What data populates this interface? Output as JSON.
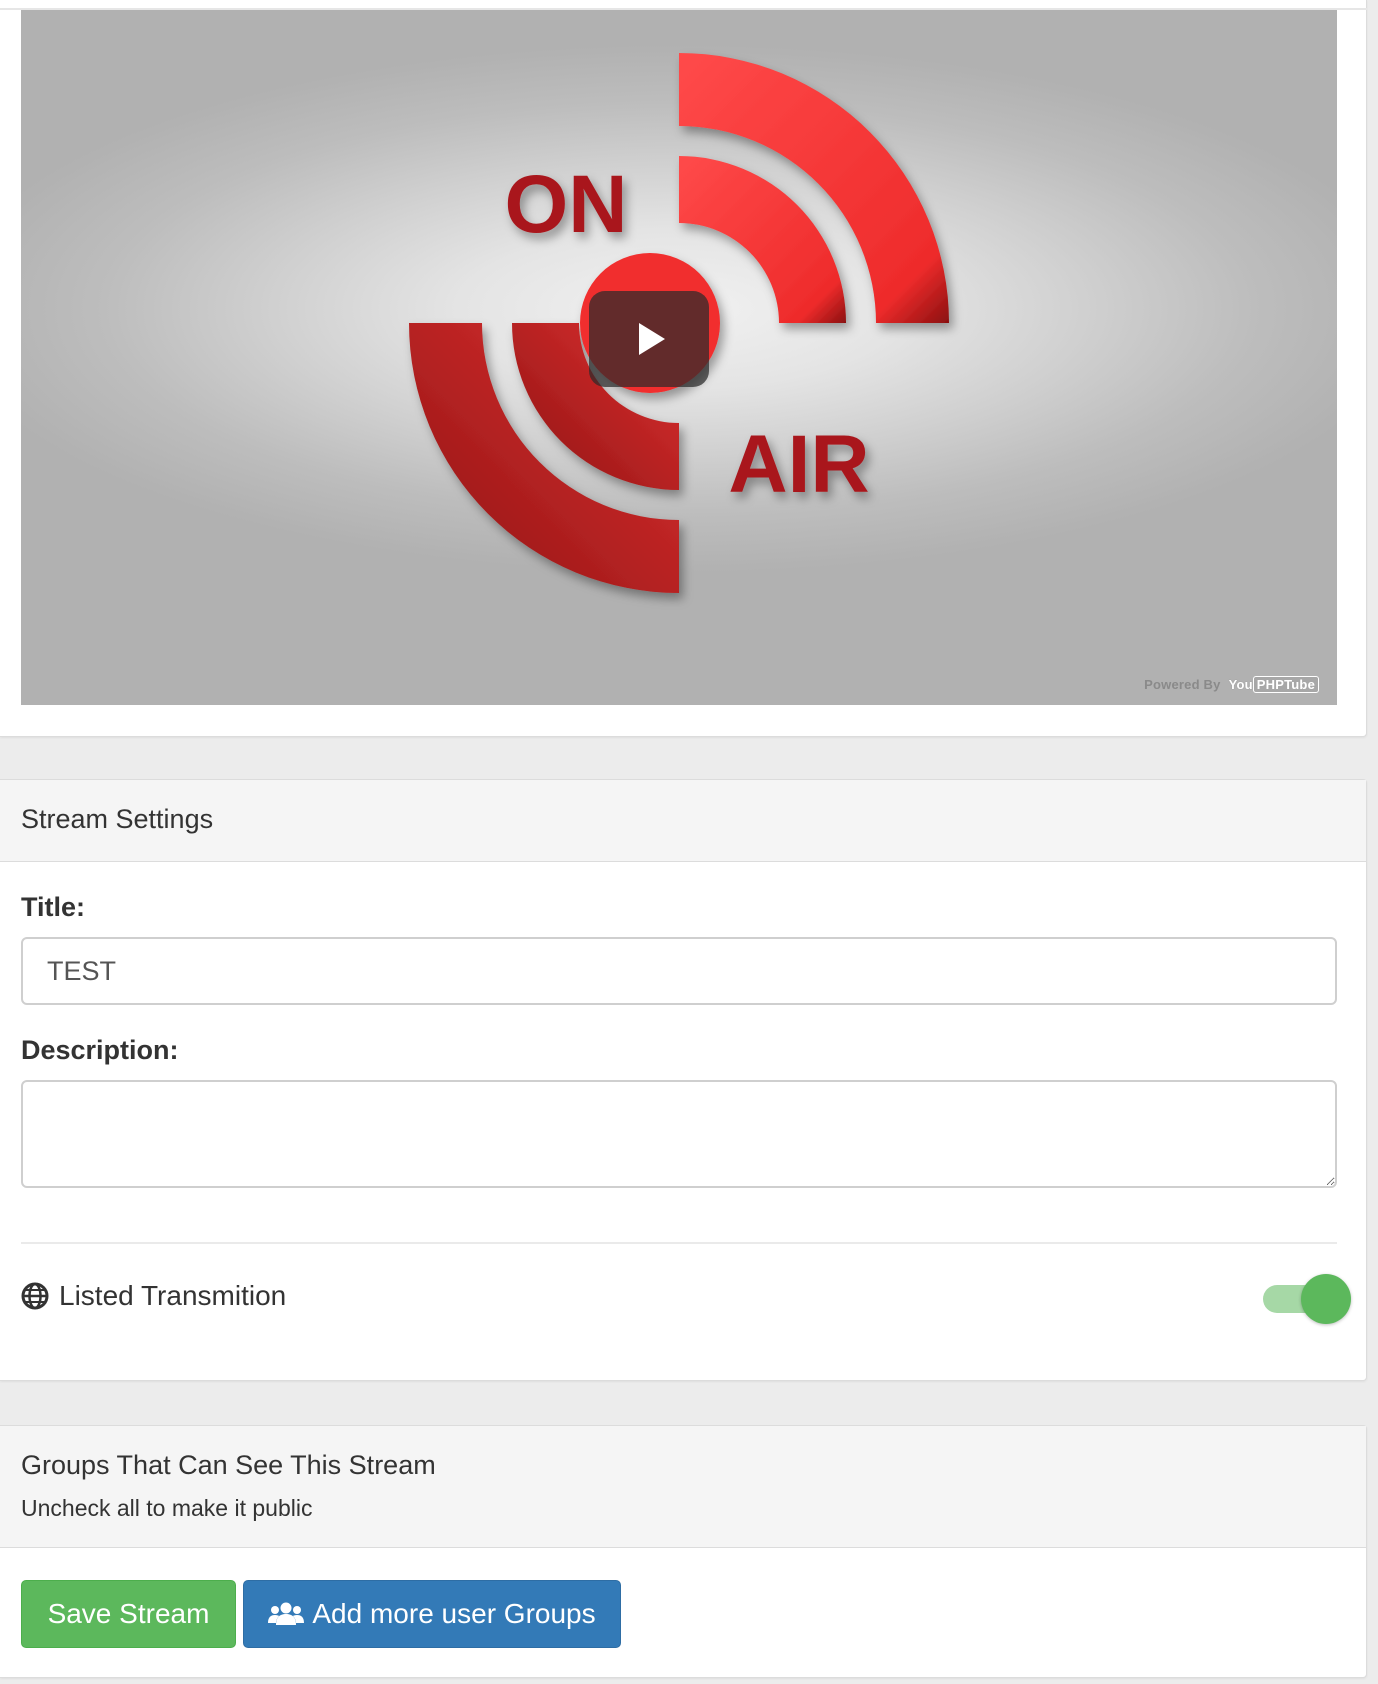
{
  "video": {
    "poster": {
      "top_word": "ON",
      "bottom_word": "AIR"
    },
    "play_icon": "play-icon",
    "powered_by_label": "Powered By",
    "brand_you": "You",
    "brand_php": "PHPTube"
  },
  "stream_settings": {
    "heading": "Stream Settings",
    "title_label": "Title:",
    "title_value": "TEST",
    "description_label": "Description:",
    "description_value": "",
    "listed_icon": "globe-icon",
    "listed_label": "Listed Transmition",
    "listed_enabled": true
  },
  "groups": {
    "heading": "Groups That Can See This Stream",
    "subheading": "Uncheck all to make it public",
    "save_label": "Save Stream",
    "add_groups_icon": "users-icon",
    "add_groups_label": "Add more user Groups"
  },
  "colors": {
    "success": "#5cb85c",
    "primary": "#337ab7",
    "on_air_red": "#e8262c"
  }
}
